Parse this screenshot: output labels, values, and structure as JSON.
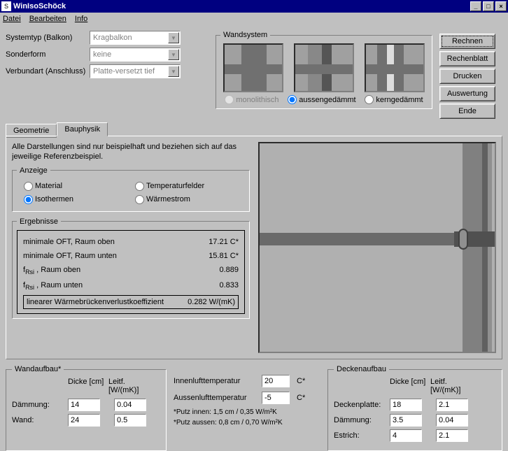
{
  "window": {
    "title": "WinIsoSchöck",
    "icon_letter": "S"
  },
  "menu": {
    "datei": "Datei",
    "bearbeiten": "Bearbeiten",
    "info": "Info"
  },
  "form": {
    "systemtyp_label": "Systemtyp (Balkon)",
    "systemtyp_value": "Kragbalkon",
    "sonderform_label": "Sonderform",
    "sonderform_value": "keine",
    "verbundart_label": "Verbundart (Anschluss)",
    "verbundart_value": "Platte-versetzt tief"
  },
  "wandsystem": {
    "legend": "Wandsystem",
    "opt1": "monolithisch",
    "opt2": "aussengedämmt",
    "opt3": "kerngedämmt"
  },
  "buttons": {
    "rechnen": "Rechnen",
    "rechenblatt": "Rechenblatt",
    "drucken": "Drucken",
    "auswertung": "Auswertung",
    "ende": "Ende"
  },
  "tabs": {
    "geometrie": "Geometrie",
    "bauphysik": "Bauphysik"
  },
  "pane": {
    "note": "Alle Darstellungen sind nur beispielhaft und beziehen sich auf das jeweilige Referenzbeispiel.",
    "anzeige_legend": "Anzeige",
    "material": "Material",
    "temperaturfelder": "Temperaturfelder",
    "isothermen": "Isothermen",
    "waermestrom": "Wärmestrom",
    "ergebnisse_legend": "Ergebnisse",
    "r1l": "minimale OFT, Raum oben",
    "r1v": "17.21  C*",
    "r2l": "minimale OFT, Raum unten",
    "r2v": "15.81  C*",
    "r3l_pre": "f",
    "r3l_sub": "Rsi",
    "r3l_post": " , Raum oben",
    "r3v": "0.889",
    "r4l_pre": "f",
    "r4l_sub": "Rsi",
    "r4l_post": " , Raum unten",
    "r4v": "0.833",
    "r5l": "linearer Wärmebrückenverlustkoeffizient",
    "r5v": "0.282  W/(mK)"
  },
  "wand": {
    "legend": "Wandaufbau*",
    "dicke_hdr": "Dicke [cm]",
    "leitf_hdr": "Leitf. [W/(mK)]",
    "daemmung_lbl": "Dämmung:",
    "daemmung_d": "14",
    "daemmung_l": "0.04",
    "wand_lbl": "Wand:",
    "wand_d": "24",
    "wand_l": "0.5"
  },
  "mid": {
    "innen_lbl": "Innenlufttemperatur",
    "innen_v": "20",
    "c": "C*",
    "aussen_lbl": "Aussenlufttemperatur",
    "aussen_v": "-5",
    "fn1": "*Putz innen:   1,5 cm / 0,35 W/m²K",
    "fn2": "*Putz aussen: 0,8 cm / 0,70 W/m²K"
  },
  "decke": {
    "legend": "Deckenaufbau",
    "dicke_hdr": "Dicke [cm]",
    "leitf_hdr": "Leitf. [W/(mK)]",
    "platte_lbl": "Deckenplatte:",
    "platte_d": "18",
    "platte_l": "2.1",
    "daemmung_lbl": "Dämmung:",
    "daemmung_d": "3.5",
    "daemmung_l": "0.04",
    "estrich_lbl": "Estrich:",
    "estrich_d": "4",
    "estrich_l": "2.1"
  }
}
